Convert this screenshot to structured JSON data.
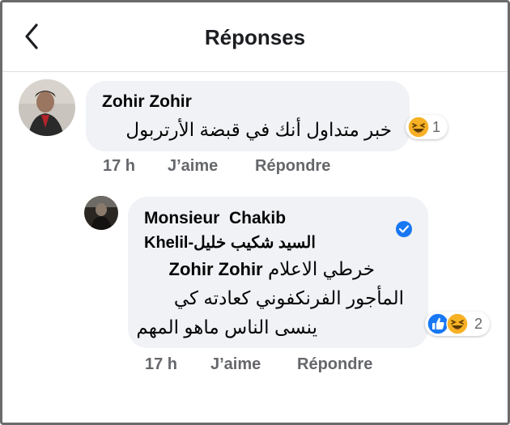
{
  "header": {
    "title": "Réponses",
    "back_icon": "chevron-left-icon"
  },
  "comments": [
    {
      "author": "Zohir Zohir",
      "text": "خبر متداول أنك في قبضة الأرتربول",
      "time": "17 h",
      "like_label": "J’aime",
      "reply_label": "Répondre",
      "reaction_icons": [
        "haha-icon"
      ],
      "reaction_count": "1"
    },
    {
      "author_line1": "Monsieur  Chakib",
      "author_line2": "Khelil-السيد شكيب خليل",
      "verified_icon": "verified-badge-icon",
      "mention": "Zohir Zohir",
      "text_line1": "خرطي الاعلام",
      "text_line2": "المأجور الفرنكفوني كعادته كي",
      "text_line3": "ينسى الناس ماهو المهم",
      "time": "17 h",
      "like_label": "J’aime",
      "reply_label": "Répondre",
      "reaction_icons": [
        "like-icon",
        "haha-icon"
      ],
      "reaction_count": "2"
    }
  ],
  "colors": {
    "bubble": "#f0f2f5",
    "meta": "#65676b",
    "like_blue": "#1877f2",
    "haha_yellow": "#f7b125",
    "verified": "#1877f2"
  }
}
